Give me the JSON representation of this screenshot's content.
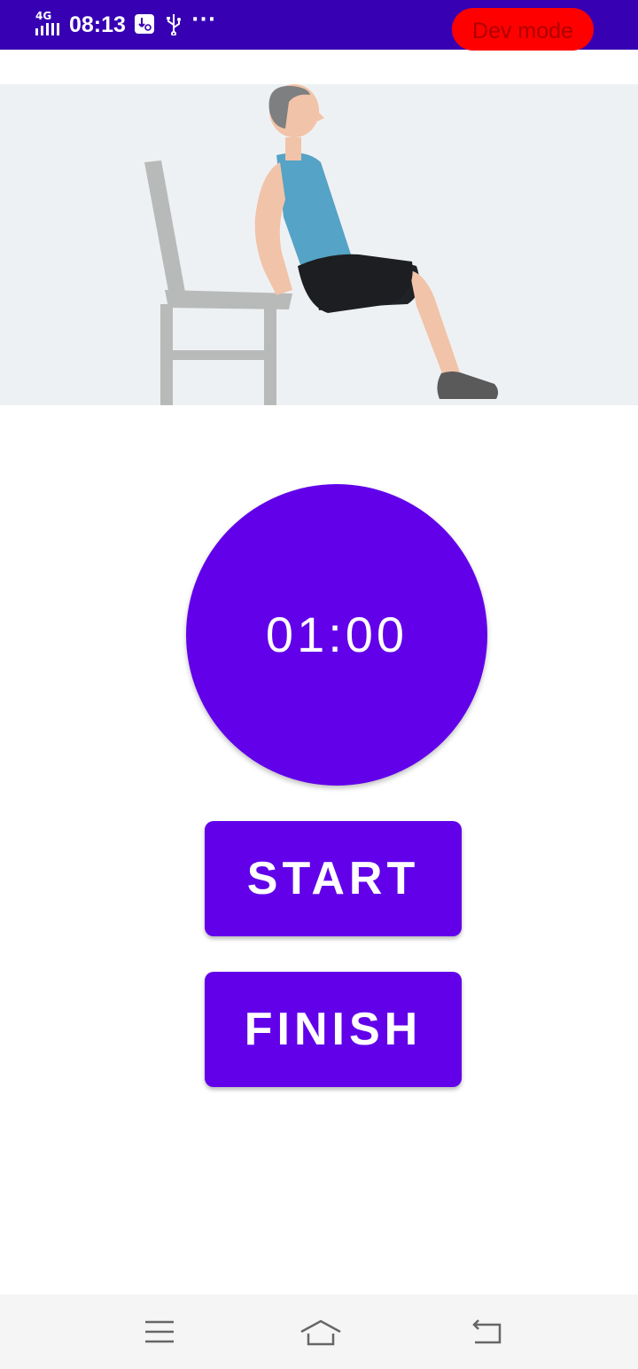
{
  "status_bar": {
    "network": "4G",
    "time": "08:13",
    "more": "···",
    "dev_mode_label": "Dev mode",
    "icons": [
      "signal-icon",
      "usb-debug-icon",
      "usb-icon",
      "more-icon"
    ],
    "background": "#3700b3",
    "dev_mode_color": "#ff0000"
  },
  "exercise": {
    "illustration": "man-doing-chair-dips-illustration"
  },
  "timer": {
    "value": "01:00"
  },
  "buttons": {
    "start_label": "START",
    "finish_label": "FINISH",
    "color": "#6200ea"
  },
  "nav_bar": {
    "icons": [
      "menu-icon",
      "home-icon",
      "back-icon"
    ]
  }
}
